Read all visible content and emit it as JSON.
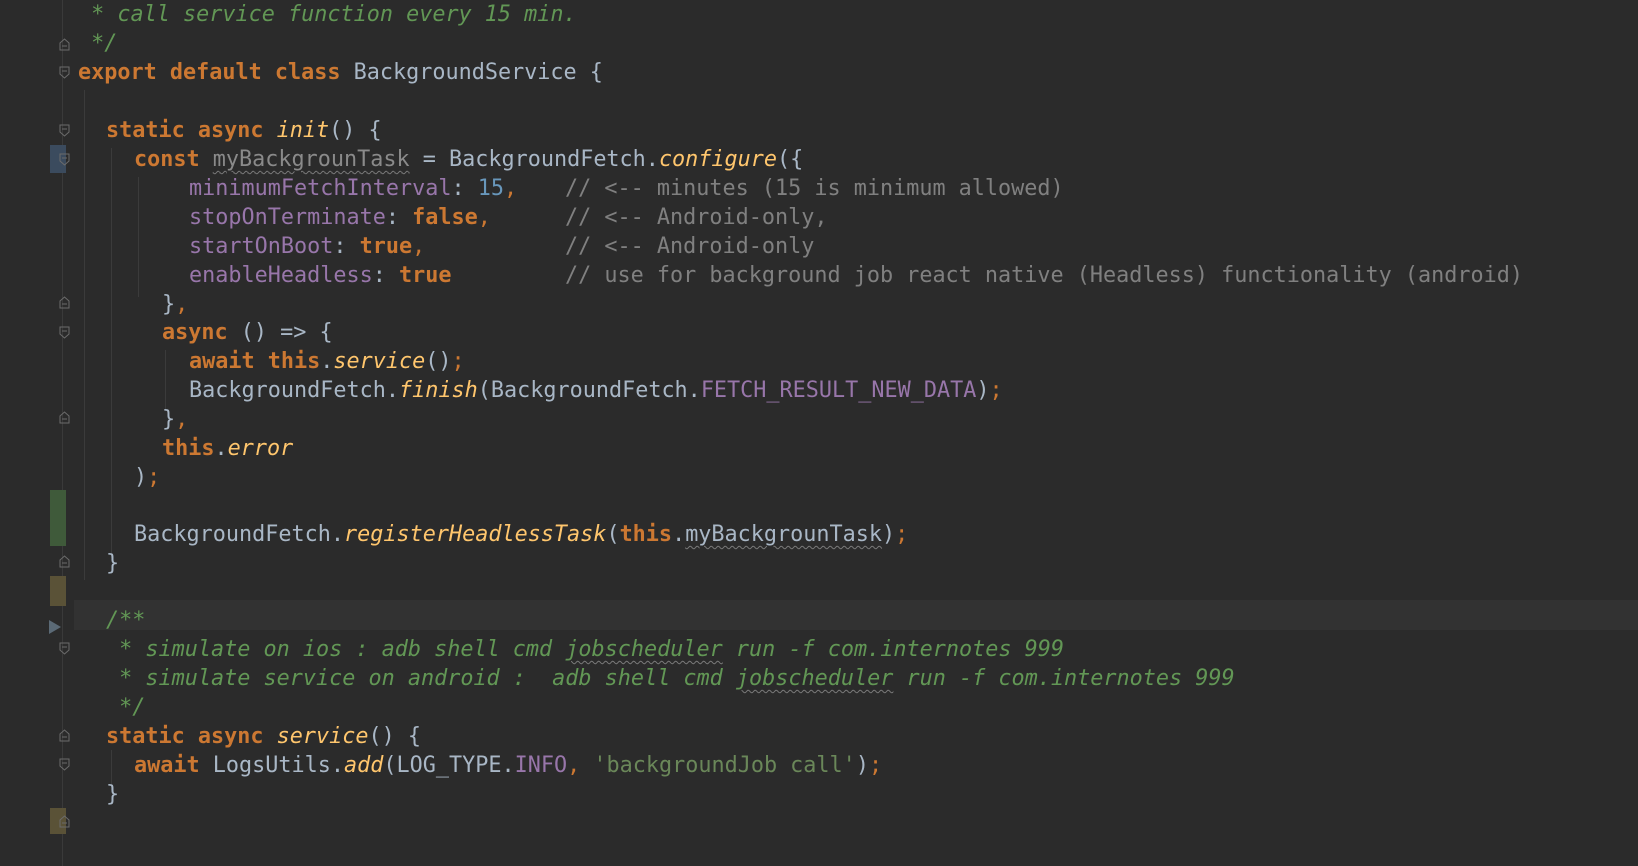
{
  "editor": {
    "theme_background": "#2b2b2b",
    "colors": {
      "keyword": "#cc7832",
      "function": "#ffc66d",
      "property": "#9876aa",
      "number": "#6897bb",
      "string": "#6a8759",
      "comment": "#808080",
      "doc_comment": "#629755",
      "plain": "#a9b7c6"
    }
  },
  "code": {
    "l1": {
      "doc": " * call service function every 15 min."
    },
    "l2": {
      "doc": " */"
    },
    "l3": {
      "kw": "export default class",
      "name": " BackgroundService {"
    },
    "l5": {
      "kw": "static async",
      "fn": "init",
      "rest": "() {"
    },
    "l6": {
      "kw": "const",
      "var": "myBackgrounTask",
      "eq": " = BackgroundFetch.",
      "fn": "configure",
      "rest": "({"
    },
    "l7": {
      "prop": "minimumFetchInterval",
      "colon": ": ",
      "num": "15",
      "comma": ",",
      "cmt": "// <-- minutes (15 is minimum allowed)"
    },
    "l8": {
      "prop": "stopOnTerminate",
      "colon": ": ",
      "kw": "false",
      "comma": ",",
      "cmt": "// <-- Android-only,"
    },
    "l9": {
      "prop": "startOnBoot",
      "colon": ": ",
      "kw": "true",
      "comma": ",",
      "cmt": "// <-- Android-only"
    },
    "l10": {
      "prop": "enableHeadless",
      "colon": ": ",
      "kw": "true",
      "cmt": "// use for background job react native (Headless) functionality (android)"
    },
    "l11": {
      "text": "}",
      "comma": ","
    },
    "l12": {
      "kw": "async",
      "rest": " () => {"
    },
    "l13": {
      "kw1": "await",
      "kw2": "this",
      "dot": ".",
      "fn": "service",
      "rest": "()",
      "semi": ";"
    },
    "l14": {
      "pre": "BackgroundFetch.",
      "fn": "finish",
      "mid": "(BackgroundFetch.",
      "prop": "FETCH_RESULT_NEW_DATA",
      "rest": ")",
      "semi": ";"
    },
    "l15": {
      "text": "}",
      "comma": ","
    },
    "l16": {
      "kw": "this",
      "dot": ".",
      "fn": "error"
    },
    "l17": {
      "text": ")",
      "semi": ";"
    },
    "l19": {
      "pre": "BackgroundFetch.",
      "fn": "registerHeadlessTask",
      "open": "(",
      "kw": "this",
      "dot": ".",
      "var": "myBackgrounTask",
      "rest": ")",
      "semi": ";"
    },
    "l20": {
      "text": "}"
    },
    "l22": {
      "doc": "/**"
    },
    "l23": {
      "doc_a": " * simulate on ios : adb shell cmd ",
      "doc_sq": "jobscheduler",
      "doc_b": " run -f com.internotes 999"
    },
    "l24": {
      "doc_a": " * simulate service on android :  adb shell cmd ",
      "doc_sq": "jobscheduler",
      "doc_b": " run -f com.internotes 999"
    },
    "l25": {
      "doc": " */"
    },
    "l26": {
      "kw": "static async",
      "fn": "service",
      "rest": "() {"
    },
    "l27": {
      "kw": "await",
      "pre": " LogsUtils.",
      "fn": "add",
      "mid": "(LOG_TYPE.",
      "prop": "INFO",
      "comma": ",",
      "str": "'backgroundJob call'",
      "rest": ")",
      "semi": ";"
    },
    "l28": {
      "text": "}"
    }
  },
  "gutter_icons": [
    "fold-marker-icon",
    "run-arrow-icon"
  ]
}
